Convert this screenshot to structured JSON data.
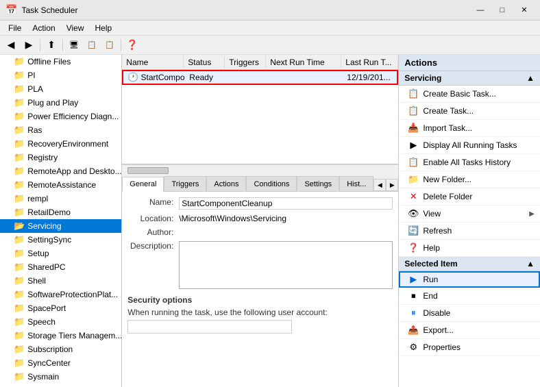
{
  "titleBar": {
    "icon": "📅",
    "title": "Task Scheduler",
    "minimizeBtn": "—",
    "maximizeBtn": "□",
    "closeBtn": "✕"
  },
  "menuBar": {
    "items": [
      "File",
      "Action",
      "View",
      "Help"
    ]
  },
  "toolbar": {
    "buttons": [
      "←",
      "→",
      "⬆",
      "🖥",
      "📋",
      "📋",
      "❓"
    ]
  },
  "sidebar": {
    "items": [
      {
        "label": "Offline Files",
        "indent": 1
      },
      {
        "label": "PI",
        "indent": 1
      },
      {
        "label": "PLA",
        "indent": 1
      },
      {
        "label": "Plug and Play",
        "indent": 1
      },
      {
        "label": "Power Efficiency Diagn...",
        "indent": 1
      },
      {
        "label": "Ras",
        "indent": 1
      },
      {
        "label": "RecoveryEnvironment",
        "indent": 1
      },
      {
        "label": "Registry",
        "indent": 1
      },
      {
        "label": "RemoteApp and Deskto...",
        "indent": 1
      },
      {
        "label": "RemoteAssistance",
        "indent": 1
      },
      {
        "label": "rempl",
        "indent": 1
      },
      {
        "label": "RetailDemo",
        "indent": 1
      },
      {
        "label": "Servicing",
        "indent": 1,
        "selected": true
      },
      {
        "label": "SettingSync",
        "indent": 1
      },
      {
        "label": "Setup",
        "indent": 1
      },
      {
        "label": "SharedPC",
        "indent": 1
      },
      {
        "label": "Shell",
        "indent": 1
      },
      {
        "label": "SoftwareProtectionPlat...",
        "indent": 1
      },
      {
        "label": "SpacePort",
        "indent": 1
      },
      {
        "label": "Speech",
        "indent": 1
      },
      {
        "label": "Storage Tiers Managem...",
        "indent": 1
      },
      {
        "label": "Subscription",
        "indent": 1
      },
      {
        "label": "SyncCenter",
        "indent": 1
      },
      {
        "label": "Sysmain",
        "indent": 1
      }
    ]
  },
  "taskList": {
    "columns": [
      "Name",
      "Status",
      "Triggers",
      "Next Run Time",
      "Last Run T..."
    ],
    "rows": [
      {
        "name": "StartCompo...",
        "status": "Ready",
        "triggers": "",
        "nextRun": "",
        "lastRun": "12/19/201...",
        "selected": true
      }
    ]
  },
  "detailTabs": {
    "tabs": [
      "General",
      "Triggers",
      "Actions",
      "Conditions",
      "Settings",
      "Hist..."
    ],
    "activeTab": "General"
  },
  "detailForm": {
    "nameLabel": "Name:",
    "nameValue": "StartComponentCleanup",
    "locationLabel": "Location:",
    "locationValue": "\\Microsoft\\Windows\\Servicing",
    "authorLabel": "Author:",
    "authorValue": "",
    "descriptionLabel": "Description:",
    "descriptionValue": "",
    "securityLabel": "Security options",
    "securitySubLabel": "When running the task, use the following user account:"
  },
  "actionsPanel": {
    "header": "Actions",
    "sections": [
      {
        "title": "Servicing",
        "collapsed": false,
        "items": [
          {
            "icon": "📋",
            "label": "Create Basic Task...",
            "hasArrow": false
          },
          {
            "icon": "📋",
            "label": "Create Task...",
            "hasArrow": false
          },
          {
            "icon": "📥",
            "label": "Import Task...",
            "hasArrow": false
          },
          {
            "icon": "▶",
            "label": "Display All Running Tasks",
            "hasArrow": false
          },
          {
            "icon": "📋",
            "label": "Enable All Tasks History",
            "hasArrow": false
          },
          {
            "icon": "📁",
            "label": "New Folder...",
            "hasArrow": false
          },
          {
            "icon": "✕",
            "label": "Delete Folder",
            "hasArrow": false
          },
          {
            "icon": "👁",
            "label": "View",
            "hasArrow": true
          },
          {
            "icon": "🔄",
            "label": "Refresh",
            "hasArrow": false
          },
          {
            "icon": "❓",
            "label": "Help",
            "hasArrow": false
          }
        ]
      },
      {
        "title": "Selected Item",
        "collapsed": false,
        "items": [
          {
            "icon": "▶",
            "label": "Run",
            "hasArrow": false,
            "highlighted": true
          },
          {
            "icon": "⏹",
            "label": "End",
            "hasArrow": false
          },
          {
            "icon": "⏸",
            "label": "Disable",
            "hasArrow": false
          },
          {
            "icon": "📤",
            "label": "Export...",
            "hasArrow": false
          },
          {
            "icon": "⚙",
            "label": "Properties",
            "hasArrow": false
          }
        ]
      }
    ]
  }
}
